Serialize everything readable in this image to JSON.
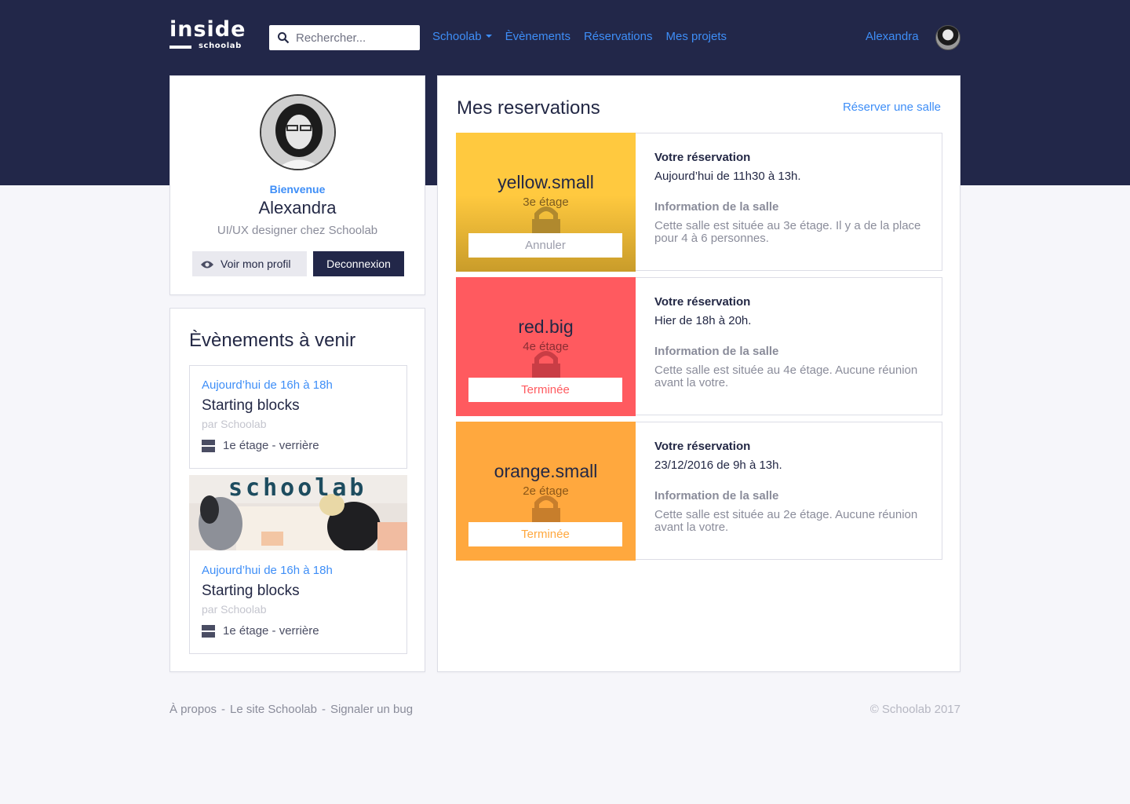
{
  "header": {
    "logo_main": "inside",
    "logo_sub": "schoolab",
    "search_placeholder": "Rechercher...",
    "nav": [
      {
        "label": "Schoolab"
      },
      {
        "label": "Èvènements"
      },
      {
        "label": "Réservations"
      },
      {
        "label": "Mes projets"
      }
    ],
    "user_name": "Alexandra"
  },
  "profile": {
    "greeting": "Bienvenue",
    "name": "Alexandra",
    "role": "UI/UX designer chez Schoolab",
    "view_profile_label": "Voir mon profil",
    "logout_label": "Deconnexion"
  },
  "events": {
    "title": "Èvènements à venir",
    "items": [
      {
        "time": "Aujourd’hui de 16h à 18h",
        "title": "Starting blocks",
        "by": "par Schoolab",
        "location": "1e étage - verrière"
      },
      {
        "time": "Aujourd’hui de 16h à 18h",
        "title": "Starting blocks",
        "by": "par Schoolab",
        "location": "1e étage - verrière",
        "image_text": "schoolab"
      }
    ]
  },
  "reservations": {
    "title": "Mes reservations",
    "book_link": "Réserver une salle",
    "items": [
      {
        "room": "yellow.small",
        "floor": "3e étage",
        "action": "Annuler",
        "color": "#ffc93f",
        "btn_color": "#9b9dab",
        "res_label": "Votre réservation",
        "res_value": "Aujourd’hui de 11h30 à 13h.",
        "info_label": "Information de la salle",
        "info_value": "Cette salle est située au 3e étage. Il y a de la place pour 4 à 6 personnes."
      },
      {
        "room": "red.big",
        "floor": "4e étage",
        "action": "Terminée",
        "color": "#ff5a5f",
        "btn_color": "#ff5a5f",
        "res_label": "Votre réservation",
        "res_value": "Hier de 18h à 20h.",
        "info_label": "Information de la salle",
        "info_value": "Cette salle est située au 4e étage. Aucune réunion avant la votre."
      },
      {
        "room": "orange.small",
        "floor": "2e étage",
        "action": "Terminée",
        "color": "#ffa83e",
        "btn_color": "#ffa83e",
        "res_label": "Votre réservation",
        "res_value": "23/12/2016 de 9h à 13h.",
        "info_label": "Information de la salle",
        "info_value": "Cette salle est située au 2e étage. Aucune réunion avant la votre."
      }
    ]
  },
  "footer": {
    "links": [
      "À propos",
      "Le site Schoolab",
      "Signaler un bug"
    ],
    "separator": "-",
    "copyright": "© Schoolab 2017"
  },
  "colors": {
    "navy": "#222749",
    "accent": "#3e8ef7"
  }
}
